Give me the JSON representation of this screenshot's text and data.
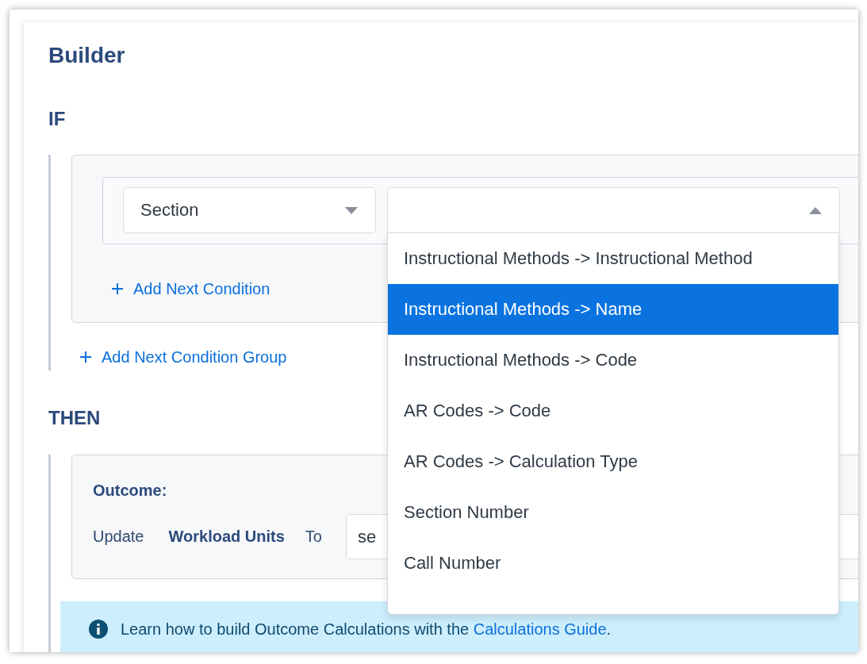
{
  "title": "Builder",
  "if_section": {
    "heading": "IF",
    "condition": {
      "field": "Section",
      "value_select": {
        "expanded": true,
        "options": [
          {
            "label": "Instructional Methods -> Instructional Method",
            "selected": false
          },
          {
            "label": "Instructional Methods -> Name",
            "selected": true
          },
          {
            "label": "Instructional Methods -> Code",
            "selected": false
          },
          {
            "label": "AR Codes -> Code",
            "selected": false
          },
          {
            "label": "AR Codes -> Calculation Type",
            "selected": false
          },
          {
            "label": "Section Number",
            "selected": false
          },
          {
            "label": "Call Number",
            "selected": false
          }
        ]
      }
    },
    "add_condition": "Add Next Condition",
    "add_group": "Add Next Condition Group"
  },
  "then_section": {
    "heading": "THEN",
    "outcome": {
      "label": "Outcome:",
      "verb": "Update",
      "target": "Workload Units",
      "preposition": "To",
      "value": "se"
    }
  },
  "info": {
    "text": "Learn how to build Outcome Calculations with the ",
    "link": "Calculations Guide",
    "end": "."
  }
}
